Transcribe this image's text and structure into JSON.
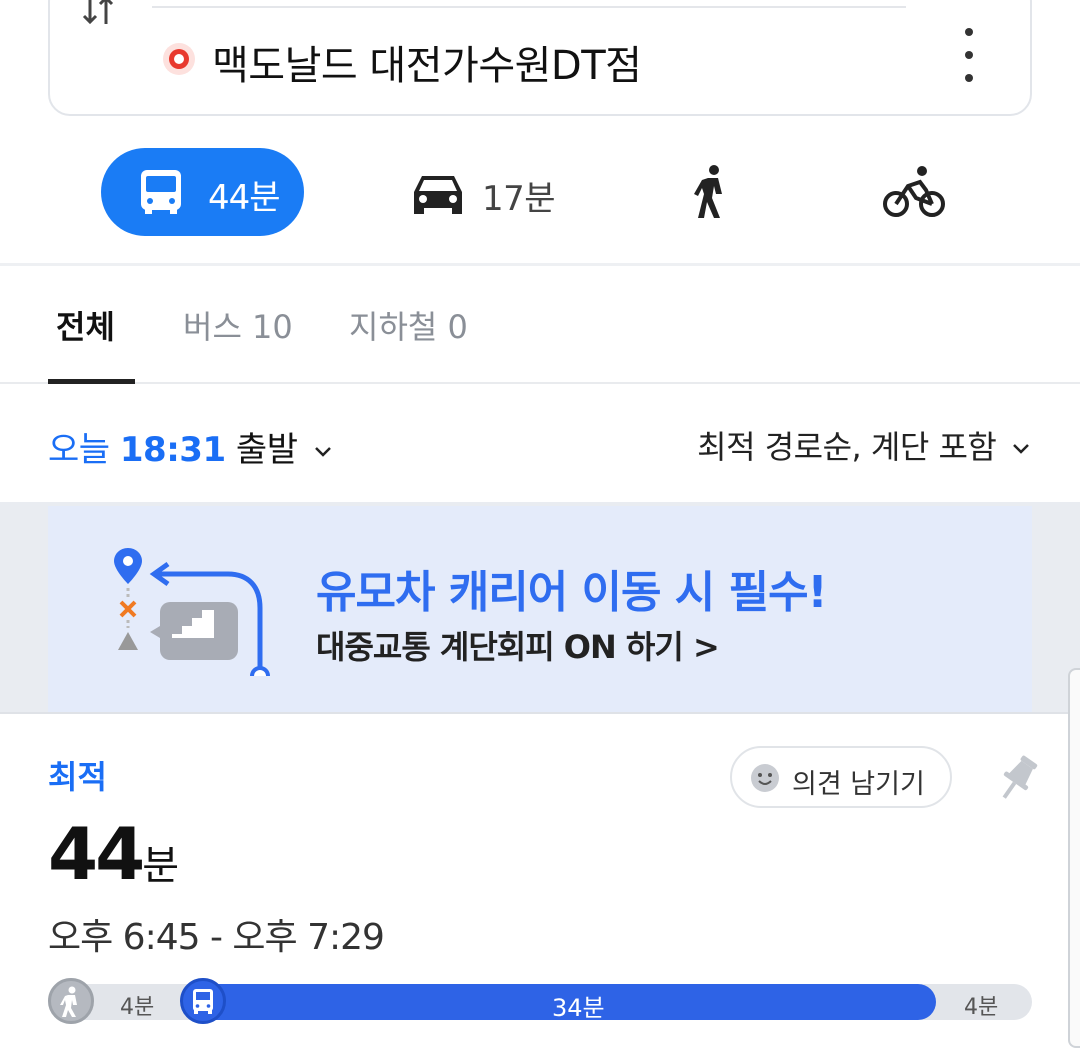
{
  "route": {
    "destination": "맥도날드 대전가수원DT점"
  },
  "modes": {
    "bus_time": "44분",
    "car_time": "17분"
  },
  "tabs": {
    "all": "전체",
    "bus": "버스 10",
    "subway": "지하철 0"
  },
  "departure": {
    "day": "오늘",
    "time": "18:31",
    "label": "출발"
  },
  "sort": {
    "label": "최적 경로순, 계단 포함"
  },
  "banner": {
    "title": "유모차 캐리어 이동 시 필수!",
    "subtitle": "대중교통 계단회피 ON 하기 >"
  },
  "result": {
    "badge": "최적",
    "feedback_label": "의견 남기기",
    "duration_num": "44",
    "duration_unit": "분",
    "time_range": "오후 6:45 - 오후 7:29",
    "segments": {
      "walk_start": "4분",
      "bus": "34분",
      "walk_end": "4분"
    }
  },
  "colors": {
    "accent": "#1a7cf5",
    "bus_segment": "#2e63e6",
    "banner_bg": "#e4ebfa"
  }
}
